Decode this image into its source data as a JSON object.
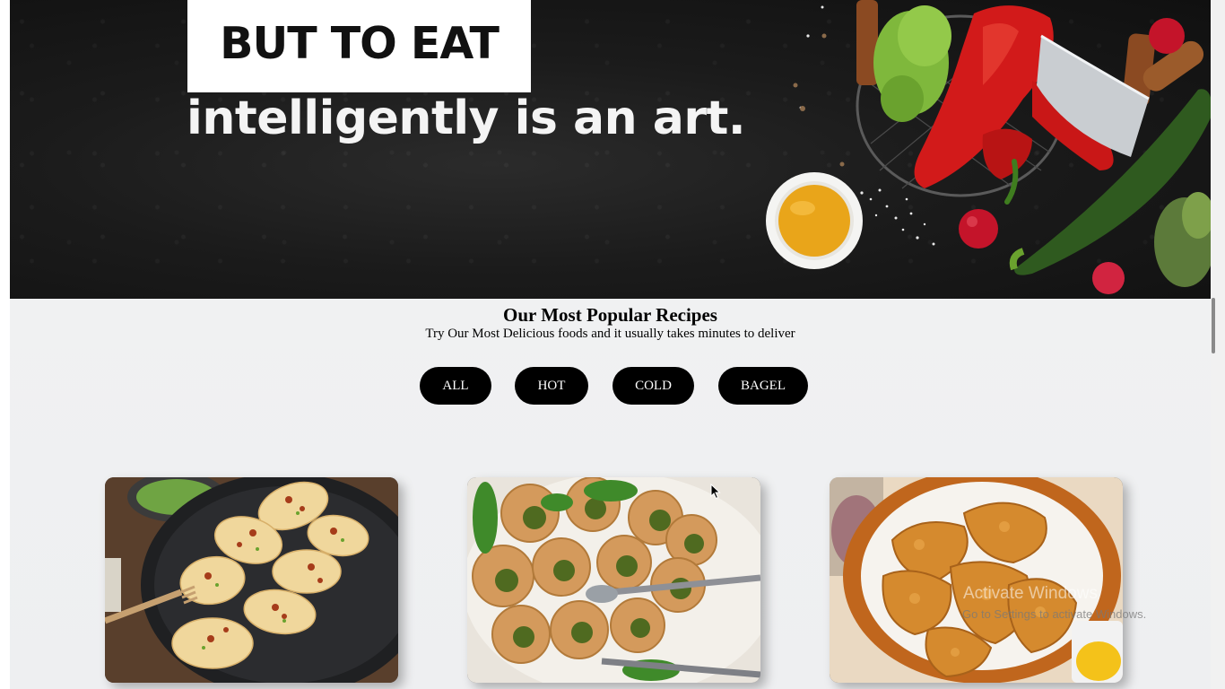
{
  "hero": {
    "headline": "BUT TO EAT",
    "tagline": "intelligently is an art."
  },
  "recipes": {
    "title": "Our Most Popular Recipes",
    "subtitle": "Try Our Most Delicious foods and it usually takes minutes to deliver",
    "filters": [
      "ALL",
      "HOT",
      "COLD",
      "BAGEL"
    ]
  },
  "cards": [
    {
      "image": "pierogi-dumplings-with-bacon"
    },
    {
      "image": "escargot-snails-with-herbs"
    },
    {
      "image": "fried-chicken-basket"
    }
  ],
  "watermark": {
    "title": "Activate Windows",
    "subtitle": "Go to Settings to activate Windows."
  },
  "colors": {
    "hero_bg": "#1b1b1b",
    "section_bg": "#f0f1f2",
    "button_bg": "#000000",
    "button_text": "#ffffff"
  }
}
